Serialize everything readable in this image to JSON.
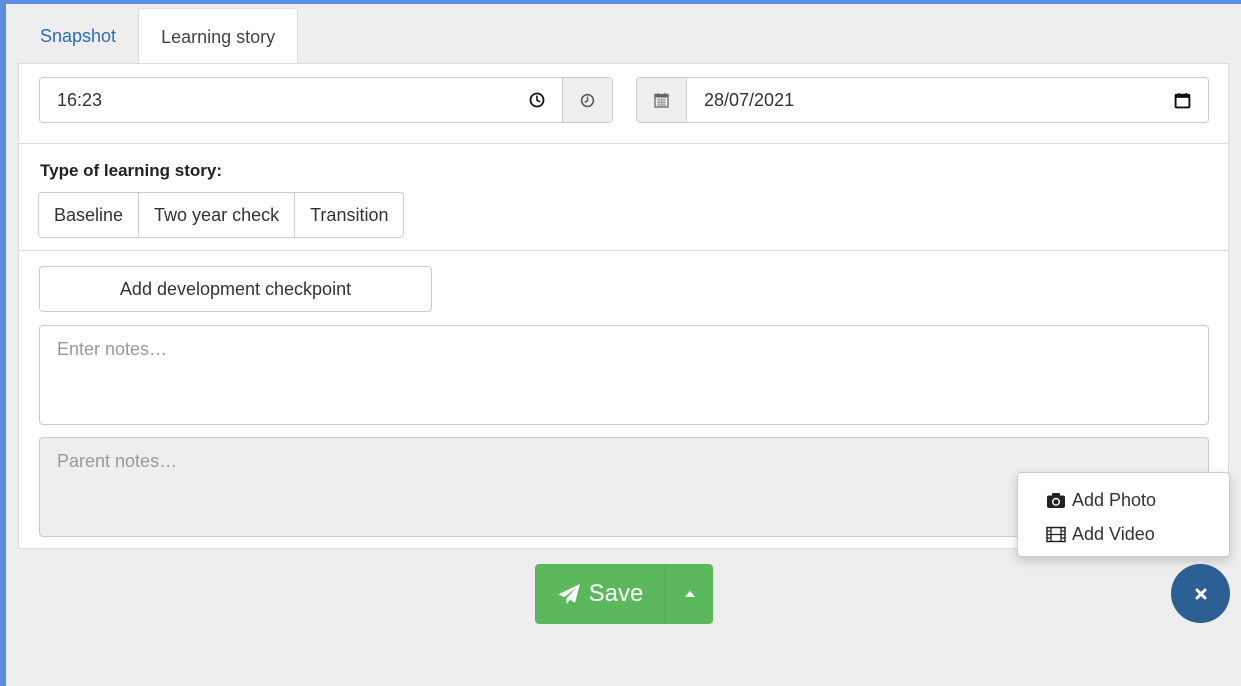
{
  "tabs": [
    {
      "label": "Snapshot",
      "active": false
    },
    {
      "label": "Learning story",
      "active": true
    }
  ],
  "time": {
    "value": "16:23",
    "icon": "clock-icon"
  },
  "date": {
    "value": "28/07/2021",
    "icon": "calendar-icon"
  },
  "story_type": {
    "label": "Type of learning story:",
    "options": [
      "Baseline",
      "Two year check",
      "Transition"
    ]
  },
  "checkpoint_button": "Add development checkpoint",
  "notes": {
    "placeholder": "Enter notes…"
  },
  "parent_notes": {
    "placeholder": "Parent notes…"
  },
  "save": {
    "label": "Save",
    "color": "#5cb85c"
  },
  "menu": {
    "items": [
      {
        "label": "Add Photo",
        "icon": "camera-icon"
      },
      {
        "label": "Add Video",
        "icon": "film-icon"
      }
    ]
  },
  "fab": {
    "icon": "close-icon",
    "color": "#2c5f93"
  }
}
